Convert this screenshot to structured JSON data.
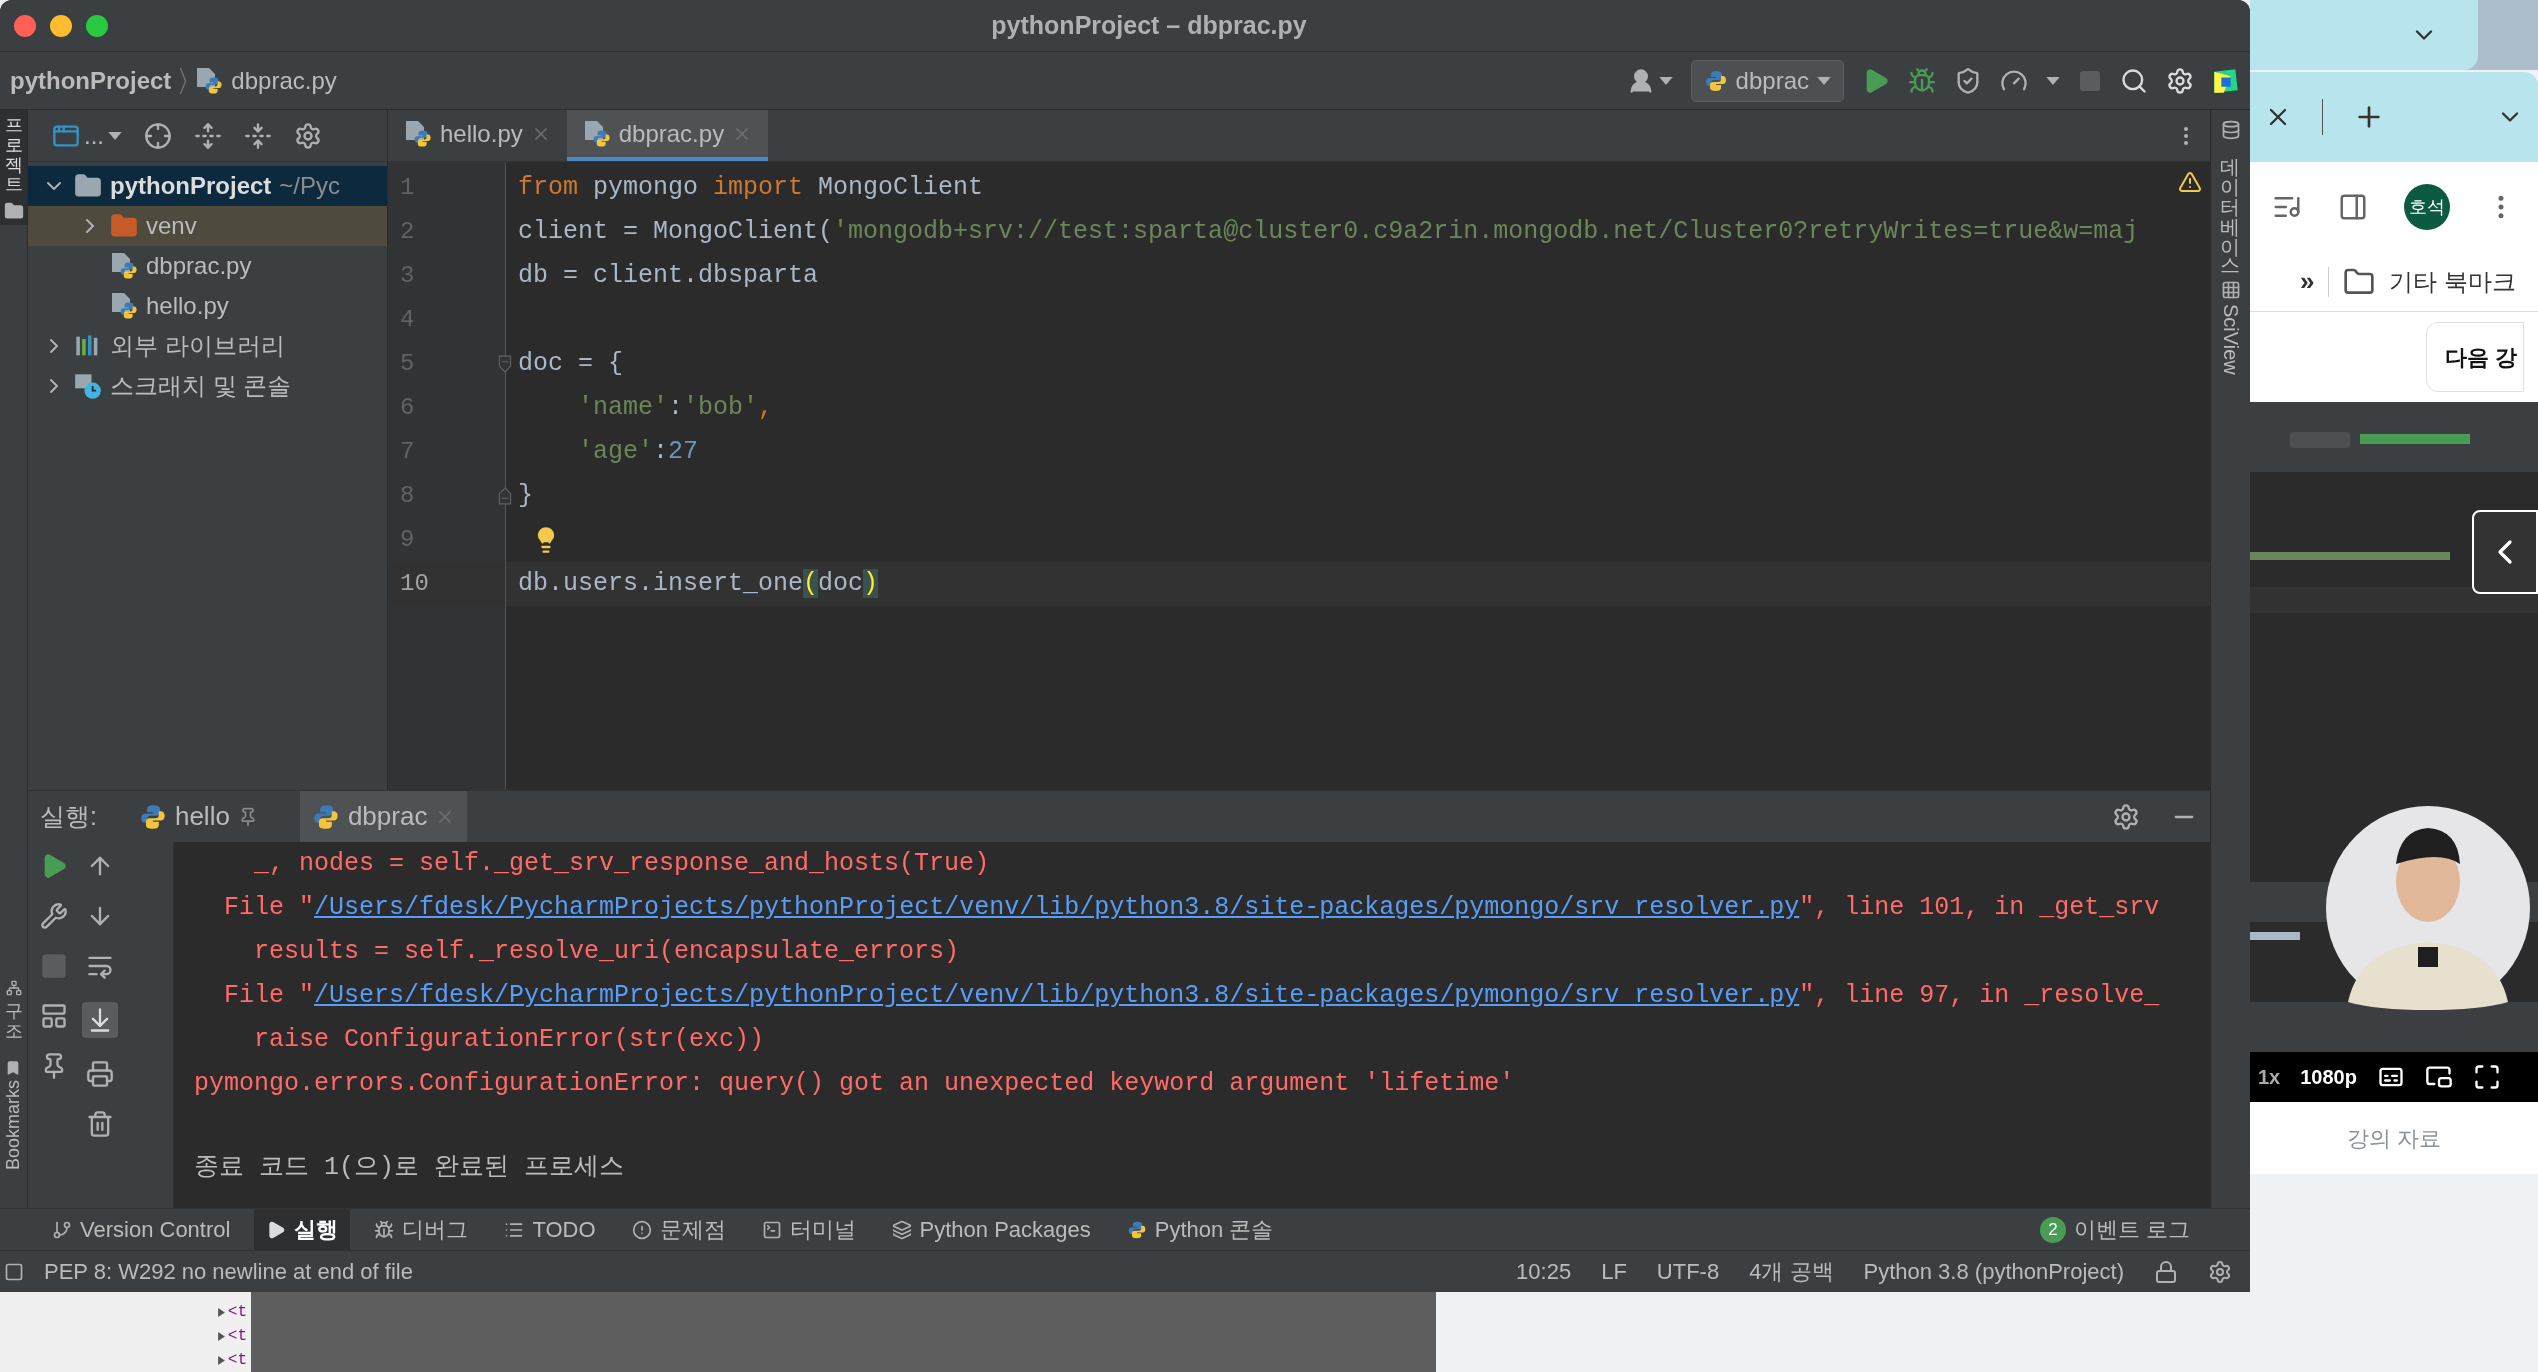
{
  "window": {
    "title": "pythonProject – dbprac.py"
  },
  "breadcrumb": [
    {
      "label": "pythonProject",
      "kind": "project"
    },
    {
      "label": "dbprac.py",
      "kind": "file"
    }
  ],
  "run_config": "dbprac",
  "left_stripe": {
    "top": "프로젝트",
    "bottom": [
      "구조",
      "Bookmarks"
    ]
  },
  "project_toolbar": {
    "view": "..."
  },
  "tree": [
    {
      "name": "pythonProject",
      "path": "~/Pyc",
      "kind": "project",
      "expanded": true,
      "selected": true,
      "children": [
        {
          "name": "venv",
          "kind": "excluded_folder",
          "expanded": false,
          "selected": false
        },
        {
          "name": "dbprac.py",
          "kind": "python_file",
          "selected": false
        },
        {
          "name": "hello.py",
          "kind": "python_file",
          "selected": false
        }
      ]
    },
    {
      "name": "외부 라이브러리",
      "kind": "library",
      "expanded": false,
      "selected": false
    },
    {
      "name": "스크래치 및 콘솔",
      "kind": "scratches",
      "expanded": false,
      "selected": false
    }
  ],
  "editor_tabs": [
    {
      "label": "hello.py",
      "selected": false
    },
    {
      "label": "dbprac.py",
      "selected": true
    }
  ],
  "code": [
    {
      "number": "1",
      "current": false,
      "kind": "code",
      "tokens": [
        {
          "text": "from",
          "kind": "keyword"
        },
        {
          "text": " pymongo ",
          "kind": "plain"
        },
        {
          "text": "import",
          "kind": "keyword"
        },
        {
          "text": " MongoClient",
          "kind": "plain"
        }
      ]
    },
    {
      "number": "2",
      "current": false,
      "kind": "code",
      "tokens": [
        {
          "text": "client = MongoClient(",
          "kind": "plain"
        },
        {
          "text": "'mongodb+srv://test:sparta@cluster0.c9a2rin.mongodb.net/Cluster0?retryWrites=true&w=maj",
          "kind": "string"
        }
      ]
    },
    {
      "number": "3",
      "current": false,
      "kind": "code",
      "tokens": [
        {
          "text": "db = client.dbsparta",
          "kind": "plain"
        }
      ]
    },
    {
      "number": "4",
      "current": false,
      "kind": "blank"
    },
    {
      "number": "5",
      "current": false,
      "kind": "fold_start",
      "tokens": [
        {
          "text": "doc = {",
          "kind": "plain"
        }
      ]
    },
    {
      "number": "6",
      "current": false,
      "kind": "code",
      "tokens": [
        {
          "text": "    'name'",
          "kind": "string"
        },
        {
          "text": ":",
          "kind": "plain"
        },
        {
          "text": "'bob'",
          "kind": "string"
        },
        {
          "text": ",",
          "kind": "keyword"
        }
      ]
    },
    {
      "number": "7",
      "current": false,
      "kind": "code",
      "tokens": [
        {
          "text": "    'age'",
          "kind": "string"
        },
        {
          "text": ":",
          "kind": "plain"
        },
        {
          "text": "27",
          "kind": "number"
        }
      ]
    },
    {
      "number": "8",
      "current": false,
      "kind": "fold_end",
      "tokens": [
        {
          "text": "}",
          "kind": "plain"
        }
      ]
    },
    {
      "number": "9",
      "current": false,
      "kind": "bulb"
    },
    {
      "number": "10",
      "current": true,
      "kind": "code",
      "tokens": [
        {
          "text": "db.users.insert_one",
          "kind": "plain"
        },
        {
          "text": "(",
          "kind": "brace"
        },
        {
          "text": "doc",
          "kind": "plain"
        },
        {
          "text": ")",
          "kind": "brace"
        }
      ]
    }
  ],
  "right_stripe": [
    "데이터베이스",
    "SciView"
  ],
  "run": {
    "label": "실행:",
    "tabs": [
      {
        "label": "hello",
        "pinned": true,
        "selected": false
      },
      {
        "label": "dbprac",
        "pinned": false,
        "selected": true
      }
    ],
    "console": [
      {
        "kind": "trace",
        "segments": [
          {
            "text": "    _, nodes = self._get_srv_response_and_hosts(True)",
            "kind": "error"
          }
        ]
      },
      {
        "kind": "trace",
        "segments": [
          {
            "text": "  File \"",
            "kind": "error"
          },
          {
            "text": "/Users/fdesk/PycharmProjects/pythonProject/venv/lib/python3.8/site-packages/pymongo/srv_resolver.py",
            "kind": "link"
          },
          {
            "text": "\", line 101, in _get_srv",
            "kind": "error"
          }
        ]
      },
      {
        "kind": "trace",
        "segments": [
          {
            "text": "    results = self._resolve_uri(encapsulate_errors)",
            "kind": "error"
          }
        ]
      },
      {
        "kind": "trace",
        "segments": [
          {
            "text": "  File \"",
            "kind": "error"
          },
          {
            "text": "/Users/fdesk/PycharmProjects/pythonProject/venv/lib/python3.8/site-packages/pymongo/srv_resolver.py",
            "kind": "link"
          },
          {
            "text": "\", line 97, in _resolve_",
            "kind": "error"
          }
        ]
      },
      {
        "kind": "trace",
        "segments": [
          {
            "text": "    raise ConfigurationError(str(exc))",
            "kind": "error"
          }
        ]
      },
      {
        "kind": "trace",
        "segments": [
          {
            "text": "pymongo.errors.ConfigurationError: query() got an unexpected keyword argument 'lifetime'",
            "kind": "error"
          }
        ]
      },
      {
        "kind": "exit",
        "segments": [
          {
            "text": "종료 코드 1(으)로 완료된 프로세스",
            "kind": "info"
          }
        ]
      }
    ]
  },
  "tool_windows": [
    {
      "label": "Version Control",
      "kind": "vcs",
      "selected": false
    },
    {
      "label": "실행",
      "kind": "run",
      "selected": true
    },
    {
      "label": "디버그",
      "kind": "debug",
      "selected": false
    },
    {
      "label": "TODO",
      "kind": "todo",
      "selected": false
    },
    {
      "label": "문제점",
      "kind": "problems",
      "selected": false
    },
    {
      "label": "터미널",
      "kind": "terminal",
      "selected": false
    },
    {
      "label": "Python Packages",
      "kind": "packages",
      "selected": false
    },
    {
      "label": "Python 콘솔",
      "kind": "console",
      "selected": false
    }
  ],
  "event_log": {
    "count": "2",
    "label": "이벤트 로그"
  },
  "status": {
    "message": "PEP 8: W292 no newline at end of file",
    "items": [
      "10:25",
      "LF",
      "UTF-8",
      "4개 공백",
      "Python 3.8 (pythonProject)"
    ]
  },
  "devtools_rows": [
    "<t",
    "<t",
    "<t"
  ],
  "browser": {
    "profile": "호석",
    "bookmark_overflow": "»",
    "bookmark_folder": "기타 북마크",
    "next_button": "다음 강",
    "video": {
      "speed": "1x",
      "quality": "1080p"
    },
    "materials_tab": "강의 자료"
  }
}
